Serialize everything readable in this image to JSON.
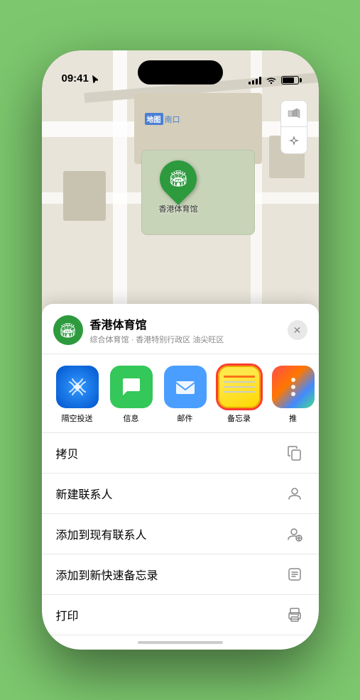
{
  "phone": {
    "status_bar": {
      "time": "09:41",
      "signal": "●●●●",
      "wifi": "wifi",
      "battery": "battery"
    }
  },
  "map": {
    "label_box": "地图",
    "label_nankou": "南口",
    "pin_label": "香港体育馆",
    "map_icon_label": "🗺️",
    "location_icon_label": "⊕"
  },
  "location_card": {
    "icon": "🏟",
    "name": "香港体育馆",
    "detail": "综合体育馆 · 香港特别行政区 油尖旺区",
    "close_label": "✕"
  },
  "share_apps": [
    {
      "id": "airdrop",
      "label": "隔空投送",
      "type": "airdrop"
    },
    {
      "id": "messages",
      "label": "信息",
      "type": "messages"
    },
    {
      "id": "mail",
      "label": "邮件",
      "type": "mail"
    },
    {
      "id": "notes",
      "label": "备忘录",
      "type": "notes",
      "selected": true
    },
    {
      "id": "more",
      "label": "推",
      "type": "more"
    }
  ],
  "actions": [
    {
      "id": "copy",
      "label": "拷贝",
      "icon": "copy"
    },
    {
      "id": "new-contact",
      "label": "新建联系人",
      "icon": "person"
    },
    {
      "id": "add-existing",
      "label": "添加到现有联系人",
      "icon": "person-add"
    },
    {
      "id": "add-notes",
      "label": "添加到新快速备忘录",
      "icon": "note"
    },
    {
      "id": "print",
      "label": "打印",
      "icon": "printer"
    }
  ]
}
